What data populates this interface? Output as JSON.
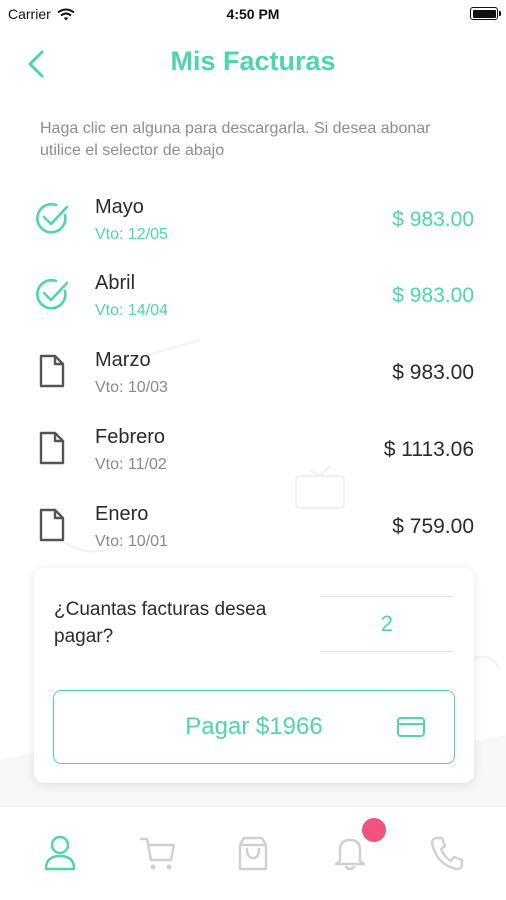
{
  "status_bar": {
    "carrier": "Carrier",
    "time": "4:50 PM"
  },
  "header": {
    "title": "Mis Facturas",
    "back_icon": "chevron-left-icon"
  },
  "instructions": "Haga clic en alguna para descargarla. Si desea abonar utilice el selector de abajo",
  "invoices": [
    {
      "month": "Mayo",
      "due": "Vto: 12/05",
      "amount": "$ 983.00",
      "status": "paid",
      "icon": "check-circle-icon"
    },
    {
      "month": "Abril",
      "due": "Vto: 14/04",
      "amount": "$ 983.00",
      "status": "paid",
      "icon": "check-circle-icon"
    },
    {
      "month": "Marzo",
      "due": "Vto: 10/03",
      "amount": "$ 983.00",
      "status": "pending",
      "icon": "document-icon"
    },
    {
      "month": "Febrero",
      "due": "Vto: 11/02",
      "amount": "$ 1113.06",
      "status": "pending",
      "icon": "document-icon"
    },
    {
      "month": "Enero",
      "due": "Vto: 10/01",
      "amount": "$ 759.00",
      "status": "pending",
      "icon": "document-icon"
    }
  ],
  "payment": {
    "question": "¿Cuantas facturas desea pagar?",
    "quantity": "2",
    "pay_label": "Pagar $1966",
    "pay_icon": "credit-card-icon"
  },
  "tab_bar": {
    "tabs": [
      {
        "icon": "user-icon",
        "active": true
      },
      {
        "icon": "cart-icon",
        "active": false
      },
      {
        "icon": "shopping-bag-icon",
        "active": false
      },
      {
        "icon": "bell-icon",
        "active": false,
        "badge": true
      },
      {
        "icon": "phone-icon",
        "active": false
      }
    ]
  },
  "colors": {
    "accent": "#4fd4ae",
    "text": "#2b2b2b",
    "muted": "#8a8a8a",
    "inactive_icon": "#cfcfcf",
    "badge": "#f0547e"
  }
}
